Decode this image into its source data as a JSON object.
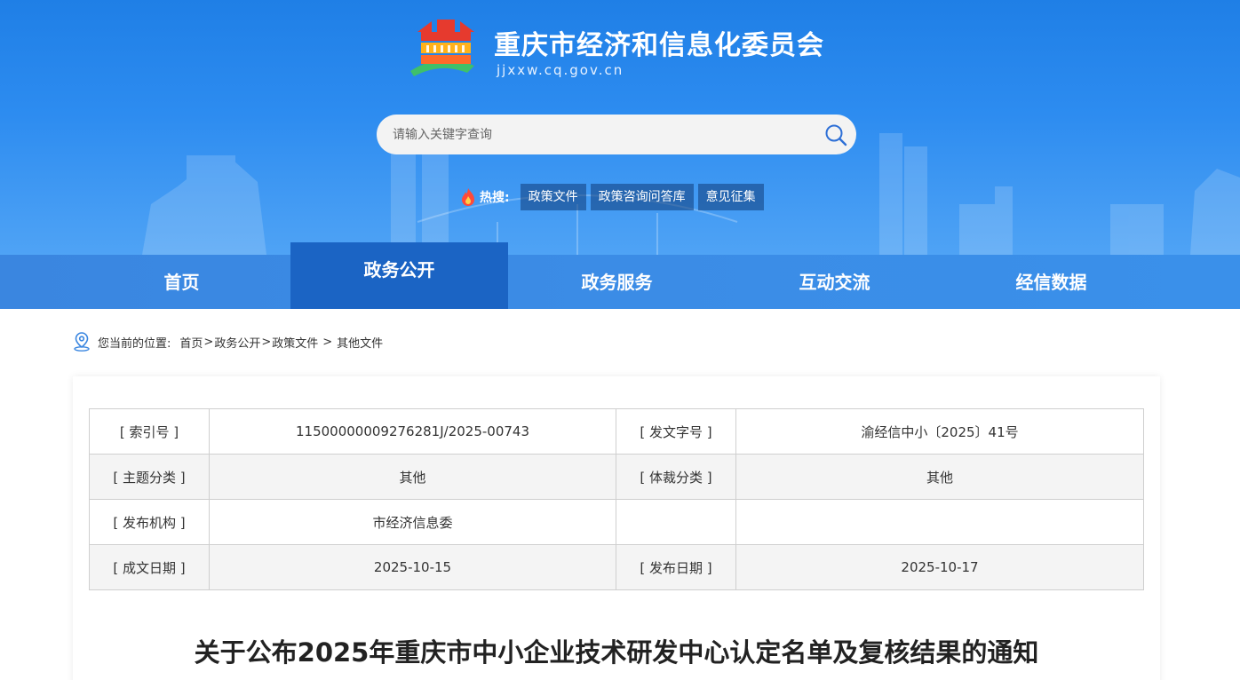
{
  "site": {
    "title": "重庆市经济和信息化委员会",
    "domain": "jjxxw.cq.gov.cn"
  },
  "search": {
    "placeholder": "请输入关键字查询"
  },
  "hot": {
    "label": "热搜:",
    "tags": [
      "政策文件",
      "政策咨询问答库",
      "意见征集"
    ]
  },
  "nav": {
    "items": [
      "首页",
      "政务公开",
      "政务服务",
      "互动交流",
      "经信数据"
    ],
    "active": "政务公开"
  },
  "breadcrumb": {
    "prefix": "您当前的位置:",
    "items": [
      "首页",
      "政务公开",
      "政策文件",
      "其他文件"
    ]
  },
  "meta": {
    "rows": [
      {
        "k1": "[ 索引号 ]",
        "v1": "11500000009276281J/2025-00743",
        "k2": "[ 发文字号 ]",
        "v2": "渝经信中小〔2025〕41号"
      },
      {
        "k1": "[ 主题分类 ]",
        "v1": "其他",
        "k2": "[ 体裁分类 ]",
        "v2": "其他"
      },
      {
        "k1": "[ 发布机构 ]",
        "v1": "市经济信息委",
        "k2": "",
        "v2": ""
      },
      {
        "k1": "[ 成文日期 ]",
        "v1": "2025-10-15",
        "k2": "[ 发布日期 ]",
        "v2": "2025-10-17"
      }
    ]
  },
  "document": {
    "title": "关于公布2025年重庆市中小企业技术研发中心认定名单及复核结果的通知"
  },
  "colors": {
    "header_blue": "#2d8cf0",
    "nav_active": "#1b64c4",
    "nav_bg": "#3b8ce6"
  }
}
